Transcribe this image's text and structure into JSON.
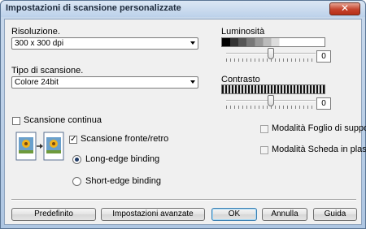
{
  "window": {
    "title": "Impostazioni di scansione personalizzate",
    "close_glyph": "✕"
  },
  "resolution": {
    "label": "Risoluzione.",
    "value": "300 x 300 dpi"
  },
  "scan_type": {
    "label": "Tipo di scansione.",
    "value": "Colore 24bit"
  },
  "brightness": {
    "label": "Luminosità",
    "value": "0",
    "level_fraction": 0.5
  },
  "contrast": {
    "label": "Contrasto",
    "value": "0",
    "level_fraction": 0.5
  },
  "continuous_scan": {
    "label": "Scansione continua",
    "checked": false
  },
  "duplex": {
    "label": "Scansione fronte/retro",
    "checked": true,
    "check_glyph": "✓"
  },
  "binding": {
    "long_edge": {
      "label": "Long-edge binding",
      "selected": true
    },
    "short_edge": {
      "label": "Short-edge binding",
      "selected": false
    }
  },
  "carrier_sheet": {
    "label": "Modalità Foglio di supporto",
    "checked": false,
    "enabled": false
  },
  "plastic_card": {
    "label": "Modalità Scheda in plastica",
    "checked": false,
    "enabled": false
  },
  "buttons": {
    "default": "Predefinito",
    "advanced": "Impostazioni avanzate",
    "ok": "OK",
    "cancel": "Annulla",
    "help": "Guida"
  }
}
